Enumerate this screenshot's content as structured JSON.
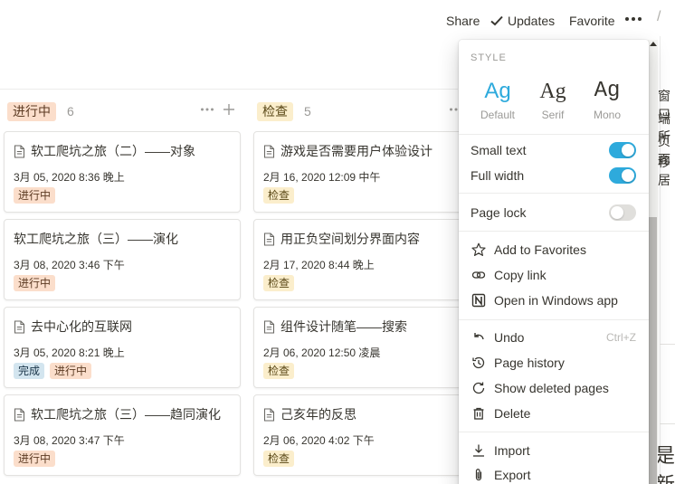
{
  "topbar": {
    "share": "Share",
    "updates": "Updates",
    "favorite": "Favorite",
    "more": "•••"
  },
  "columns": [
    {
      "tag": "进行中",
      "count": "6",
      "cards": [
        {
          "title": "软工爬坑之旅（二）——对象",
          "icon": true,
          "date": "3月 05, 2020 8:36 晚上",
          "tags": [
            {
              "label": "进行中",
              "kind": "progress"
            }
          ]
        },
        {
          "title": "软工爬坑之旅（三）——演化",
          "icon": false,
          "date": "3月 08, 2020 3:46 下午",
          "tags": [
            {
              "label": "进行中",
              "kind": "progress"
            }
          ]
        },
        {
          "title": "去中心化的互联网",
          "icon": true,
          "date": "3月 05, 2020 8:21 晚上",
          "tags": [
            {
              "label": "完成",
              "kind": "done"
            },
            {
              "label": "进行中",
              "kind": "progress"
            }
          ]
        },
        {
          "title": "软工爬坑之旅（三）——趋同演化",
          "icon": true,
          "date": "3月 08, 2020 3:47 下午",
          "tags": [
            {
              "label": "进行中",
              "kind": "progress"
            }
          ]
        }
      ]
    },
    {
      "tag": "检查",
      "count": "5",
      "cards": [
        {
          "title": "游戏是否需要用户体验设计",
          "icon": true,
          "date": "2月 16, 2020 12:09 中午",
          "tags": [
            {
              "label": "检查",
              "kind": "check"
            }
          ]
        },
        {
          "title": "用正负空间划分界面内容",
          "icon": true,
          "date": "2月 17, 2020 8:44 晚上",
          "tags": [
            {
              "label": "检查",
              "kind": "check"
            }
          ]
        },
        {
          "title": "组件设计随笔——搜索",
          "icon": true,
          "date": "2月 06, 2020 12:50 凌晨",
          "tags": [
            {
              "label": "检查",
              "kind": "check"
            }
          ]
        },
        {
          "title": "己亥年的反思",
          "icon": true,
          "date": "2月 06, 2020 4:02 下午",
          "tags": [
            {
              "label": "检查",
              "kind": "check"
            }
          ]
        }
      ]
    }
  ],
  "menu": {
    "style_title": "STYLE",
    "styles": [
      {
        "ag": "Ag",
        "label": "Default",
        "selected": true
      },
      {
        "ag": "Ag",
        "label": "Serif",
        "selected": false
      },
      {
        "ag": "Ag",
        "label": "Mono",
        "selected": false
      }
    ],
    "small_text": "Small text",
    "full_width": "Full width",
    "page_lock": "Page lock",
    "add_favorites": "Add to Favorites",
    "copy_link": "Copy link",
    "open_windows": "Open in Windows app",
    "undo": "Undo",
    "undo_shortcut": "Ctrl+Z",
    "page_history": "Page history",
    "show_deleted": "Show deleted pages",
    "delete": "Delete",
    "import": "Import",
    "export": "Export"
  },
  "toggles": {
    "small_text": true,
    "full_width": true,
    "page_lock": false
  },
  "right_strip": {
    "chars": [
      "窗口",
      "端所",
      "页面",
      "移居"
    ],
    "big": "是新"
  },
  "colors": {
    "accent": "#2eaadc",
    "tag_progress": "#fbdecb",
    "tag_check": "#fbeecc",
    "tag_done": "#d3e5ef"
  }
}
